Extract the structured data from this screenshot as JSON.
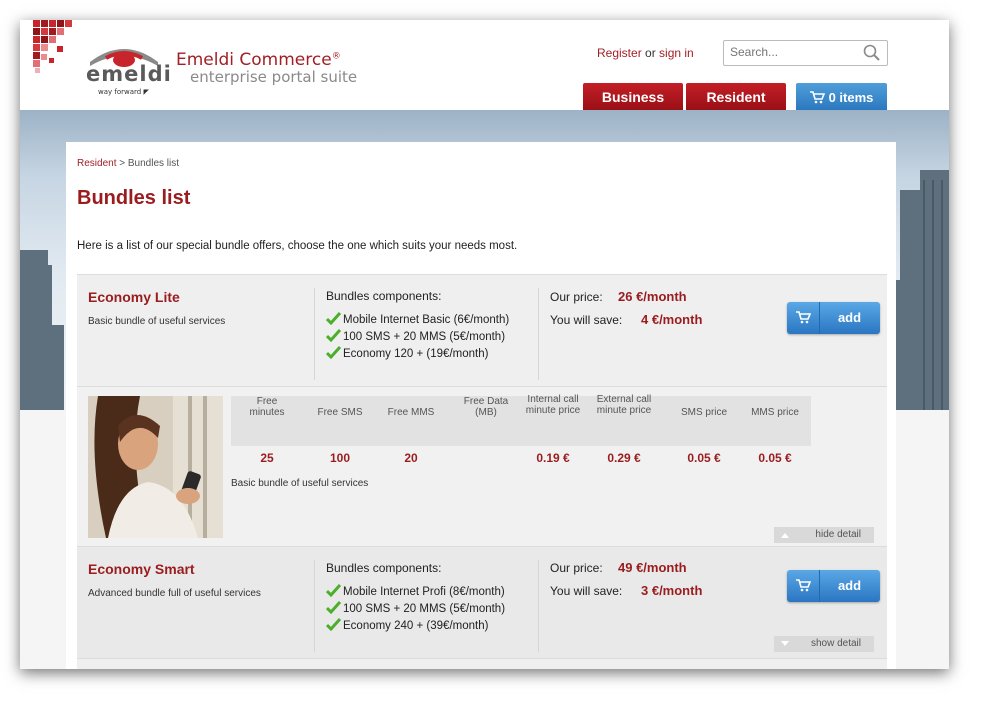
{
  "header": {
    "logo_word": "emeldi",
    "logo_tagline": "way forward",
    "brand_name": "Emeldi Commerce",
    "brand_mark": "®",
    "brand_subtitle": "enterprise portal suite",
    "register_label": "Register",
    "or_label": " or ",
    "signin_label": "sign in",
    "search_placeholder": "Search...",
    "tabs": [
      {
        "label": "Business"
      },
      {
        "label": "Resident"
      }
    ],
    "cart_label": "0 items",
    "colors": {
      "brand_red": "#a21f25",
      "cart_blue": "#3a8bd0"
    }
  },
  "breadcrumb": {
    "home": "Resident",
    "separator": ">",
    "current": "Bundles list"
  },
  "page_title": "Bundles list",
  "intro": "Here is a list of our special bundle offers, choose the one which suits your needs most.",
  "bundles": [
    {
      "name": "Economy Lite",
      "description": "Basic bundle of useful services",
      "components_label": "Bundles components:",
      "components": [
        "Mobile Internet Basic (6€/month)",
        "100 SMS + 20 MMS (5€/month)",
        "Economy 120 + (19€/month)"
      ],
      "price_label": "Our price:",
      "price": "26 €/month",
      "save_label": "You will save:",
      "save": "4 €/month",
      "add_label": "add"
    },
    {
      "name": "Economy Smart",
      "description": "Advanced bundle full of useful services",
      "components_label": "Bundles components:",
      "components": [
        "Mobile Internet Profi (8€/month)",
        "100 SMS + 20 MMS (5€/month)",
        "Economy 240 + (39€/month)"
      ],
      "price_label": "Our price:",
      "price": "49 €/month",
      "save_label": "You will save:",
      "save": "3 €/month",
      "add_label": "add"
    }
  ],
  "detail": {
    "columns": [
      "Free minutes",
      "Free SMS",
      "Free MMS",
      "Free Data (MB)",
      "Internal call minute price",
      "External call minute price",
      "SMS price",
      "MMS price"
    ],
    "values": [
      "25",
      "100",
      "20",
      "",
      "0.19 €",
      "0.29 €",
      "0.05 €",
      "0.05 €"
    ],
    "description": "Basic bundle of useful services",
    "hide_label": "hide detail"
  },
  "show_detail_label": "show detail"
}
